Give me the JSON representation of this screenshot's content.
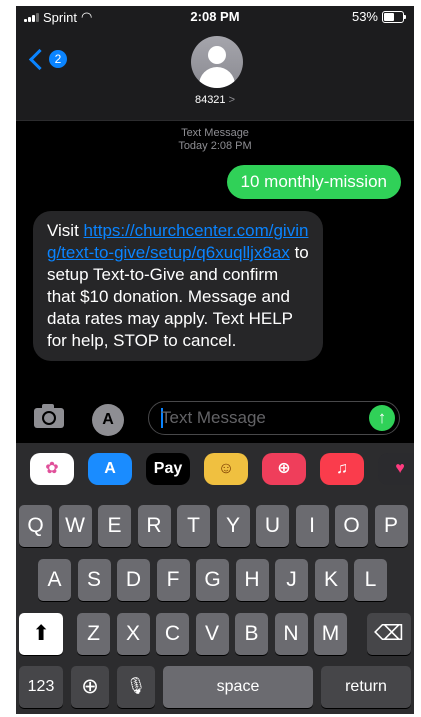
{
  "status_bar": {
    "carrier": "Sprint",
    "time": "2:08 PM",
    "battery": "53%"
  },
  "header": {
    "back_badge": "2",
    "contact": "84321",
    "contact_chevron": ">"
  },
  "conversation": {
    "meta_title": "Text Message",
    "meta_time": "Today 2:08 PM",
    "sent_message": "10 monthly-mission",
    "received": {
      "prefix": "Visit ",
      "link": "https://churchcenter.com/giving/text-to-give/setup/q6xuqlljx8ax",
      "suffix": " to setup Text-to-Give and confirm that $10 donation. Message and data rates may apply. Text HELP for help, STOP to cancel."
    }
  },
  "input": {
    "placeholder": "Text Message",
    "app_button": "A",
    "send_icon": "↑"
  },
  "app_strip": [
    {
      "name": "photos-app-icon",
      "label": "✿",
      "color": "#ffffff",
      "fg": "#e0509a"
    },
    {
      "name": "app-store-icon",
      "label": "A",
      "color": "#1a8cff",
      "fg": "#ffffff"
    },
    {
      "name": "apple-pay-icon",
      "label": "Pay",
      "color": "#000000",
      "fg": "#ffffff"
    },
    {
      "name": "memoji-icon",
      "label": "☺",
      "color": "#f0c040",
      "fg": "#7a3a00"
    },
    {
      "name": "search-images-icon",
      "label": "⊕",
      "color": "#ef3e5b",
      "fg": "#ffffff"
    },
    {
      "name": "music-icon",
      "label": "♫",
      "color": "#fa3c4c",
      "fg": "#ffffff"
    },
    {
      "name": "digital-touch-icon",
      "label": "♥",
      "color": "#2b2b2e",
      "fg": "#ff3b7f"
    }
  ],
  "keyboard": {
    "row1": [
      "Q",
      "W",
      "E",
      "R",
      "T",
      "Y",
      "U",
      "I",
      "O",
      "P"
    ],
    "row2": [
      "A",
      "S",
      "D",
      "F",
      "G",
      "H",
      "J",
      "K",
      "L"
    ],
    "row3": [
      "Z",
      "X",
      "C",
      "V",
      "B",
      "N",
      "M"
    ],
    "shift": "⬆",
    "delete": "⌫",
    "numbers": "123",
    "globe": "⊕",
    "mic": "🎙",
    "space": "space",
    "return": "return"
  }
}
